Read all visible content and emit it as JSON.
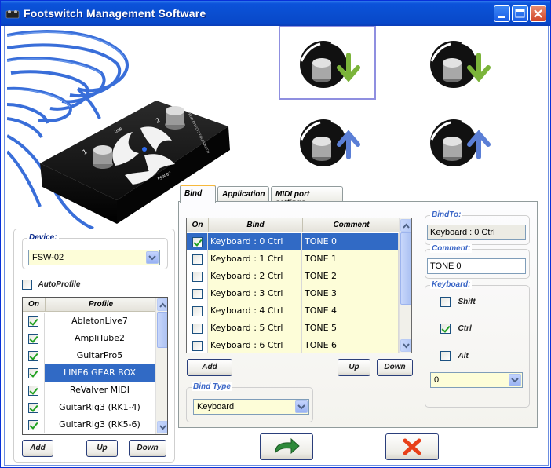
{
  "window": {
    "title": "Footswitch Management Software"
  },
  "device_panel": {
    "device_legend": "Device:",
    "device_value": "FSW-02",
    "autoprofile_label": "AutoProfile",
    "autoprofile_checked": false,
    "table_headers": {
      "on": "On",
      "profile": "Profile"
    },
    "profiles": [
      {
        "name": "AbletonLive7",
        "on": true
      },
      {
        "name": "AmpliTube2",
        "on": true
      },
      {
        "name": "GuitarPro5",
        "on": true
      },
      {
        "name": "LINE6 GEAR BOX",
        "on": true,
        "selected": true
      },
      {
        "name": "ReValver MIDI",
        "on": true
      },
      {
        "name": "GuitarRig3 (RK1-4)",
        "on": true
      },
      {
        "name": "GuitarRig3 (RK5-6)",
        "on": true
      }
    ],
    "buttons": {
      "add": "Add",
      "up": "Up",
      "down": "Down"
    }
  },
  "photo": {
    "port_1": "1",
    "port_2": "2",
    "usb": "USB",
    "model": "FSW-02",
    "brand": "PEDALEFFECTS FOOTSWITCH"
  },
  "tabs": [
    {
      "label": "Bind",
      "active": true
    },
    {
      "label": "Application",
      "active": false
    },
    {
      "label": "MIDI port settings",
      "active": false
    }
  ],
  "bind_panel": {
    "headers": {
      "on": "On",
      "bind": "Bind",
      "comment": "Comment"
    },
    "rows": [
      {
        "bind": "Keyboard : 0  Ctrl",
        "comment": "TONE 0",
        "on": true,
        "selected": true
      },
      {
        "bind": "Keyboard : 1  Ctrl",
        "comment": "TONE 1",
        "on": false
      },
      {
        "bind": "Keyboard : 2  Ctrl",
        "comment": "TONE 2",
        "on": false
      },
      {
        "bind": "Keyboard : 3  Ctrl",
        "comment": "TONE 3",
        "on": false
      },
      {
        "bind": "Keyboard : 4  Ctrl",
        "comment": "TONE 4",
        "on": false
      },
      {
        "bind": "Keyboard : 5  Ctrl",
        "comment": "TONE 5",
        "on": false
      },
      {
        "bind": "Keyboard : 6  Ctrl",
        "comment": "TONE 6",
        "on": false
      }
    ],
    "buttons": {
      "add": "Add",
      "up": "Up",
      "down": "Down"
    },
    "bind_type_legend": "Bind Type",
    "bind_type_value": "Keyboard",
    "bindto_legend": "BindTo:",
    "bindto_value": "Keyboard : 0  Ctrl",
    "comment_legend": "Comment:",
    "comment_value": "TONE 0",
    "keyboard_legend": "Keyboard:",
    "modifiers": [
      {
        "label": "Shift",
        "checked": false
      },
      {
        "label": "Ctrl",
        "checked": true
      },
      {
        "label": "Alt",
        "checked": false
      }
    ],
    "key_value": "0"
  },
  "colors": {
    "title_bar": "#0a4ed0",
    "selection": "#316ac5",
    "row_fill": "#fdfdd8",
    "arrow_down": "#7bb43a",
    "arrow_up": "#5b7fd6",
    "cancel": "#e8401a",
    "confirm": "#2e8a3a"
  }
}
